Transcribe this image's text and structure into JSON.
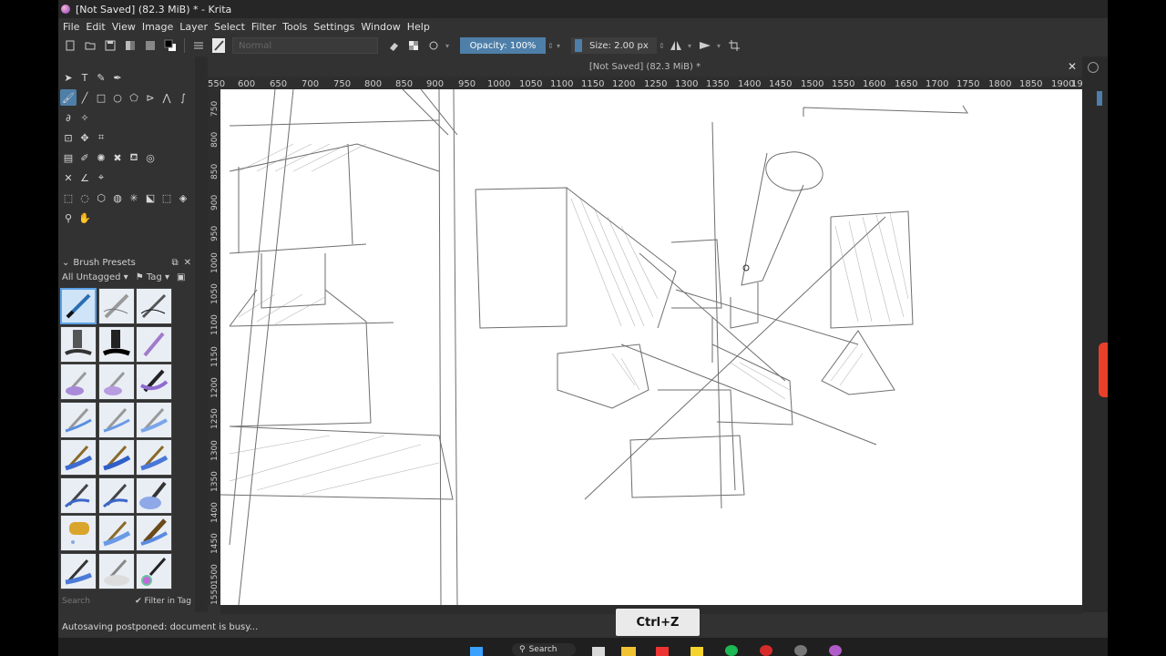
{
  "window": {
    "title": "[Not Saved]  (82.3 MiB) * - Krita"
  },
  "menu": [
    "File",
    "Edit",
    "View",
    "Image",
    "Layer",
    "Select",
    "Filter",
    "Tools",
    "Settings",
    "Window",
    "Help"
  ],
  "toolbar": {
    "blend_mode": "Normal",
    "opacity_label": "Opacity: 100%",
    "size_label": "Size: 2.00 px"
  },
  "document": {
    "tab_title": "[Not Saved]  (82.3 MiB) *",
    "ruler_h": [
      "550",
      "600",
      "650",
      "700",
      "750",
      "800",
      "850",
      "900",
      "950",
      "1000",
      "1050",
      "1100",
      "1150",
      "1200",
      "1250",
      "1300",
      "1350",
      "1400",
      "1450",
      "1500",
      "1550",
      "1600",
      "1650",
      "1700",
      "1750",
      "1800",
      "1850",
      "1900",
      "19"
    ],
    "ruler_v": [
      "750",
      "800",
      "850",
      "900",
      "950",
      "1000",
      "1050",
      "1100",
      "1150",
      "1200",
      "1250",
      "1300",
      "1350",
      "1400",
      "1450",
      "1500",
      "1550"
    ]
  },
  "brush_presets": {
    "title": "Brush Presets",
    "filter": "All Untagged",
    "tag": "Tag",
    "search_placeholder": "Search",
    "filter_in_tag": "Filter in Tag"
  },
  "status": {
    "message": "Autosaving postponed: document is busy..."
  },
  "overlay": {
    "shortcut": "Ctrl+Z"
  },
  "taskbar": {
    "search_label": "Search"
  },
  "colors": {
    "accent": "#4e7fa8",
    "canvas": "#ffffff",
    "panel": "#323232"
  }
}
